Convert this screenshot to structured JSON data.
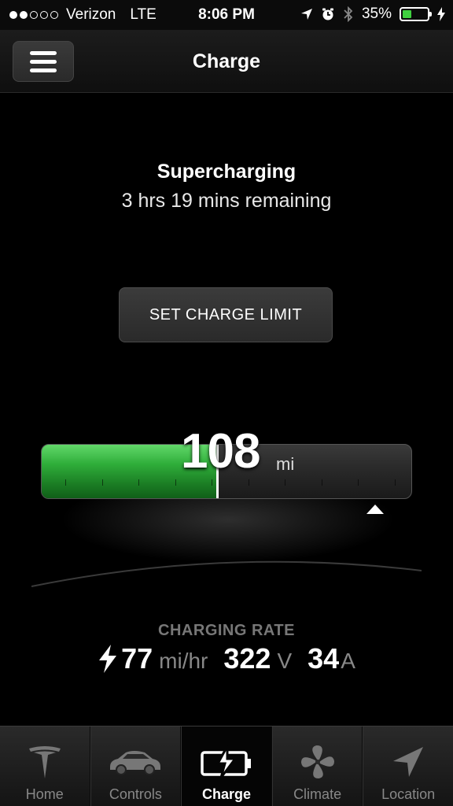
{
  "status_bar": {
    "carrier": "Verizon",
    "network": "LTE",
    "time": "8:06 PM",
    "battery_percent": "35%",
    "battery_level": 0.35,
    "signal_strength": 2,
    "icons": [
      "location-arrow-icon",
      "alarm-icon",
      "bluetooth-icon",
      "charging-bolt-icon"
    ]
  },
  "nav": {
    "title": "Charge",
    "menu_icon": "hamburger-menu-icon"
  },
  "charge": {
    "status": "Supercharging",
    "time_remaining": "3 hrs 19 mins remaining",
    "set_limit_label": "SET CHARGE LIMIT",
    "range_value": "108",
    "range_unit": "mi",
    "charge_fraction": 0.47,
    "limit_fraction": 0.9,
    "fill_color": "#2fae3a"
  },
  "rate": {
    "title": "CHARGING RATE",
    "speed_value": "77",
    "speed_unit": "mi/hr",
    "voltage_value": "322",
    "voltage_unit": "V",
    "current_value": "34",
    "current_unit": "A"
  },
  "tabs": [
    {
      "label": "Home",
      "icon": "tesla-logo-icon",
      "active": false
    },
    {
      "label": "Controls",
      "icon": "car-icon",
      "active": false
    },
    {
      "label": "Charge",
      "icon": "charging-battery-icon",
      "active": true
    },
    {
      "label": "Climate",
      "icon": "fan-icon",
      "active": false
    },
    {
      "label": "Location",
      "icon": "navigation-arrow-icon",
      "active": false
    }
  ]
}
